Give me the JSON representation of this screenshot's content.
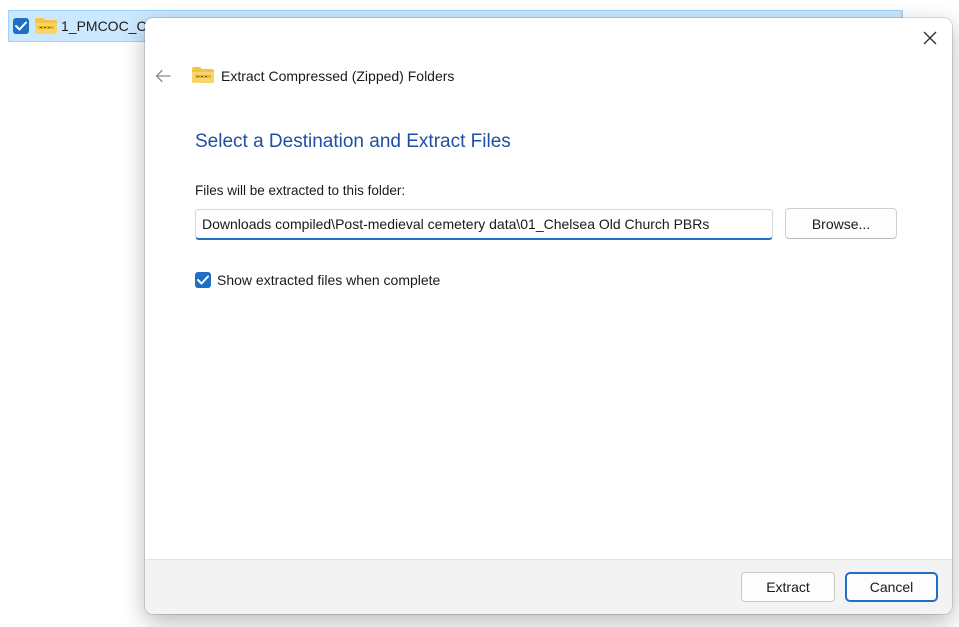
{
  "background": {
    "file_name": "1_PMCOC_C",
    "checked": true
  },
  "dialog": {
    "title": "Extract Compressed (Zipped) Folders",
    "heading": "Select a Destination and Extract Files",
    "folder_label": "Files will be extracted to this folder:",
    "path_value": "Downloads compiled\\Post-medieval cemetery data\\01_Chelsea Old Church PBRs",
    "browse_label": "Browse...",
    "show_files_label": "Show extracted files when complete",
    "show_files_checked": true,
    "extract_label": "Extract",
    "cancel_label": "Cancel"
  },
  "icons": {
    "close": "close-icon",
    "back": "back-arrow-icon",
    "zip_folder": "zip-folder-icon",
    "checkmark": "checkmark-icon"
  },
  "colors": {
    "accent": "#1f6fc5",
    "heading": "#1f4f9e",
    "selection_bg": "#cce8ff",
    "footer_bg": "#f3f3f3"
  }
}
